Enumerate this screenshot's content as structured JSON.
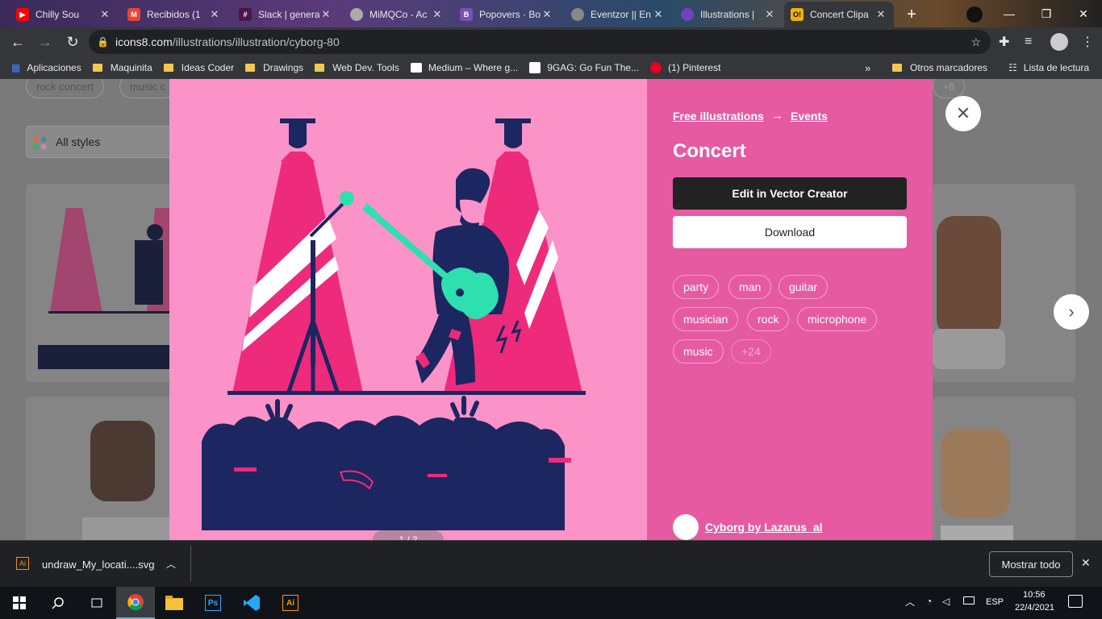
{
  "tabs": [
    {
      "title": "Chilly Sou",
      "favicon_color": "#ff0000"
    },
    {
      "title": "Recibidos (1",
      "favicon_color": "#ea4335"
    },
    {
      "title": "Slack | genera",
      "favicon_color": "#4a154b"
    },
    {
      "title": "MiMQCo - Ac",
      "favicon_color": "#aaaaaa"
    },
    {
      "title": "Popovers · Bo",
      "favicon_color": "#7952b3"
    },
    {
      "title": "Eventzor || En",
      "favicon_color": "#888888"
    },
    {
      "title": "Illustrations |",
      "favicon_color": "#6f42c1"
    },
    {
      "title": "Concert Clipa",
      "favicon_color": "#f0b400",
      "active": true
    }
  ],
  "url": {
    "host": "icons8.com",
    "path": "/illustrations/illustration/cyborg-80"
  },
  "bookmarks": [
    "Aplicaciones",
    "Maquinita",
    "Ideas Coder",
    "Drawings",
    "Web Dev. Tools",
    "Medium – Where g...",
    "9GAG: Go Fun The...",
    "(1) Pinterest"
  ],
  "bookmarks_right": [
    "Otros marcadores",
    "Lista de lectura"
  ],
  "background": {
    "search_chips": [
      "rock concert",
      "music c"
    ],
    "styles_filter": "All styles",
    "more_chip": "+8"
  },
  "modal": {
    "breadcrumb": [
      "Free illustrations",
      "Events"
    ],
    "title": "Concert",
    "edit_label": "Edit in Vector Creator",
    "download_label": "Download",
    "tags": [
      "party",
      "man",
      "guitar",
      "musician",
      "rock",
      "microphone",
      "music",
      "+24"
    ],
    "author": "Cyborg by Lazarus_al",
    "pager": "1 / 3"
  },
  "download_bar": {
    "file": "undraw_My_locati....svg",
    "show_all": "Mostrar todo"
  },
  "taskbar": {
    "time": "10:56",
    "date": "22/4/2021",
    "lang": "ESP"
  },
  "colors": {
    "pink": "#fb93c8",
    "magenta": "#e65aa2",
    "navy": "#1c2660",
    "teal": "#2ee0b0",
    "hotpink": "#ee2a7b"
  }
}
